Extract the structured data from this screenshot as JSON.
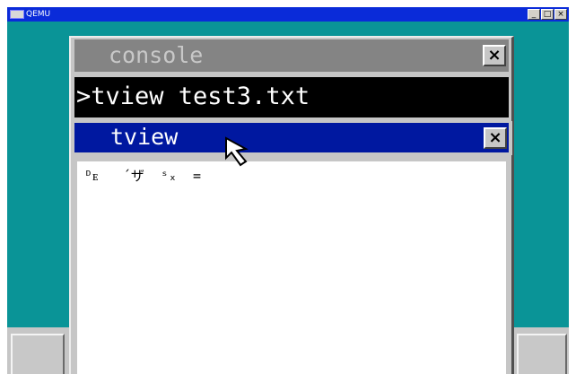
{
  "host": {
    "title": "QEMU",
    "controls": [
      "_",
      "□",
      "×"
    ]
  },
  "console": {
    "title": "console",
    "close_label": "×",
    "command": ">tview test3.txt"
  },
  "tview": {
    "title": "tview",
    "close_label": "×",
    "content": "ᴰᴇ   ´ザ  ˢₓ  ="
  },
  "colors": {
    "desktop": "#0a9497",
    "host_titlebar": "#0a2bd9",
    "console_title_inactive": "#848484",
    "tview_title_active": "#0018a0"
  },
  "icons": {
    "pointer": "arrow-cursor-icon",
    "app": "qemu-app-icon"
  }
}
